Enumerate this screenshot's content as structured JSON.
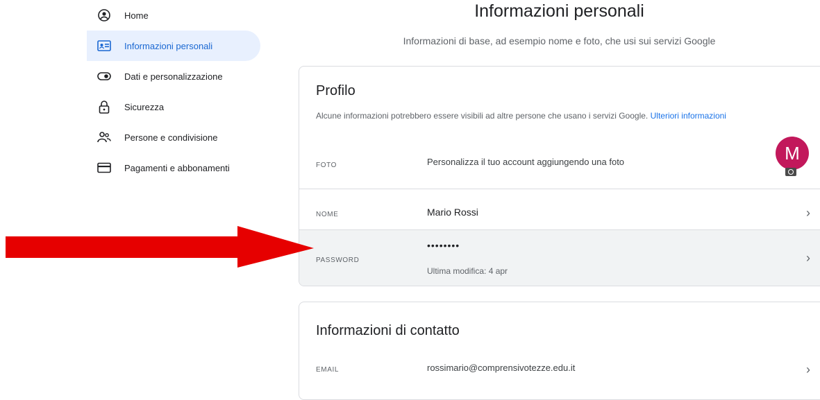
{
  "sidebar": {
    "items": [
      {
        "label": "Home",
        "icon": "account-circle-icon"
      },
      {
        "label": "Informazioni personali",
        "icon": "id-card-icon",
        "active": true
      },
      {
        "label": "Dati e personalizzazione",
        "icon": "toggle-icon"
      },
      {
        "label": "Sicurezza",
        "icon": "lock-icon"
      },
      {
        "label": "Persone e condivisione",
        "icon": "people-icon"
      },
      {
        "label": "Pagamenti e abbonamenti",
        "icon": "credit-card-icon"
      }
    ]
  },
  "header": {
    "title": "Informazioni personali",
    "subtitle": "Informazioni di base, ad esempio nome e foto, che usi sui servizi Google"
  },
  "profile": {
    "title": "Profilo",
    "description": "Alcune informazioni potrebbero essere visibili ad altre persone che usano i servizi Google.",
    "link": "Ulteriori informazioni",
    "foto": {
      "key": "FOTO",
      "value": "Personalizza il tuo account aggiungendo una foto",
      "avatar_letter": "M"
    },
    "nome": {
      "key": "NOME",
      "value": "Mario Rossi"
    },
    "password": {
      "key": "PASSWORD",
      "value": "••••••••",
      "sub": "Ultima modifica: 4 apr"
    }
  },
  "contact": {
    "title": "Informazioni di contatto",
    "email": {
      "key": "EMAIL",
      "value": "rossimario@comprensivotezze.edu.it"
    }
  },
  "colors": {
    "accent": "#1a73e8",
    "active_bg": "#e8f0fe",
    "avatar": "#c2185b",
    "annotation_arrow": "#e60000"
  },
  "chevron": "›"
}
